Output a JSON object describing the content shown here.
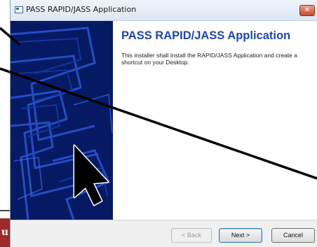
{
  "window": {
    "title": "PASS RAPID/JASS Application",
    "close_glyph": "✕"
  },
  "content": {
    "heading": "PASS RAPID/JASS Application",
    "body": "This installer shall install the RAPID/JASS Application and create a shortcut on your Desktop."
  },
  "buttons": {
    "back": "< Back",
    "next": "Next >",
    "cancel": "Cancel"
  },
  "background": {
    "tab_letter": "u"
  },
  "colors": {
    "banner": "#061a63",
    "heading": "#1f46a8",
    "close": "#c74a2e",
    "tab": "#9b2a2a"
  },
  "icons": {
    "app": "window-app-icon",
    "close": "close-icon",
    "cursor": "mouse-pointer-icon"
  }
}
